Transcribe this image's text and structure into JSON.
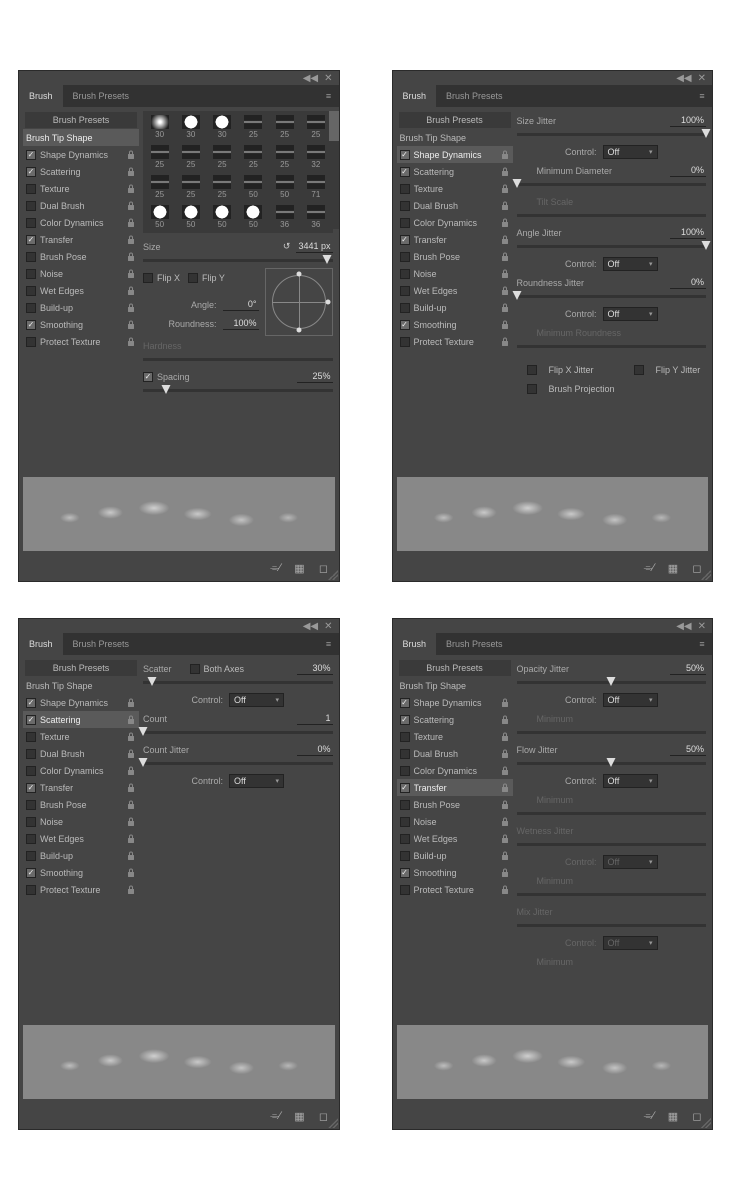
{
  "tabs": {
    "brush": "Brush",
    "presets": "Brush Presets"
  },
  "sidebar": {
    "presets_btn": "Brush Presets",
    "tip_shape": "Brush Tip Shape",
    "items": [
      {
        "label": "Shape Dynamics",
        "checked": true
      },
      {
        "label": "Scattering",
        "checked": true
      },
      {
        "label": "Texture",
        "checked": false
      },
      {
        "label": "Dual Brush",
        "checked": false
      },
      {
        "label": "Color Dynamics",
        "checked": false
      },
      {
        "label": "Transfer",
        "checked": true
      },
      {
        "label": "Brush Pose",
        "checked": false
      },
      {
        "label": "Noise",
        "checked": false
      },
      {
        "label": "Wet Edges",
        "checked": false
      },
      {
        "label": "Build-up",
        "checked": false
      },
      {
        "label": "Smoothing",
        "checked": true
      },
      {
        "label": "Protect Texture",
        "checked": false
      }
    ]
  },
  "panel1": {
    "selected": "Brush Tip Shape",
    "tips": [
      {
        "t": "soft",
        "s": "30"
      },
      {
        "t": "hard",
        "s": "30"
      },
      {
        "t": "hard",
        "s": "30"
      },
      {
        "t": "stroke",
        "s": "25"
      },
      {
        "t": "stroke",
        "s": "25"
      },
      {
        "t": "stroke",
        "s": "25"
      },
      {
        "t": "stroke",
        "s": "25"
      },
      {
        "t": "stroke",
        "s": "25"
      },
      {
        "t": "stroke",
        "s": "25"
      },
      {
        "t": "stroke",
        "s": "25"
      },
      {
        "t": "stroke",
        "s": "25"
      },
      {
        "t": "stroke",
        "s": "32"
      },
      {
        "t": "stroke",
        "s": "25"
      },
      {
        "t": "stroke",
        "s": "25"
      },
      {
        "t": "stroke",
        "s": "25"
      },
      {
        "t": "stroke",
        "s": "50"
      },
      {
        "t": "stroke",
        "s": "50"
      },
      {
        "t": "stroke",
        "s": "71"
      },
      {
        "t": "hard",
        "s": "50"
      },
      {
        "t": "hard",
        "s": "50"
      },
      {
        "t": "hard",
        "s": "50"
      },
      {
        "t": "hard",
        "s": "50"
      },
      {
        "t": "stroke",
        "s": "36"
      },
      {
        "t": "stroke",
        "s": "36"
      }
    ],
    "size_label": "Size",
    "size_value": "3441 px",
    "flipx": "Flip X",
    "flipy": "Flip Y",
    "angle_label": "Angle:",
    "angle_value": "0°",
    "roundness_label": "Roundness:",
    "roundness_value": "100%",
    "hardness_label": "Hardness",
    "spacing_label": "Spacing",
    "spacing_value": "25%"
  },
  "panel2": {
    "selected": "Shape Dynamics",
    "size_jitter_label": "Size Jitter",
    "size_jitter_value": "100%",
    "control_label": "Control:",
    "control_off": "Off",
    "min_diam_label": "Minimum Diameter",
    "min_diam_value": "0%",
    "tilt_scale_label": "Tilt Scale",
    "angle_jitter_label": "Angle Jitter",
    "angle_jitter_value": "100%",
    "round_jitter_label": "Roundness Jitter",
    "round_jitter_value": "0%",
    "min_round_label": "Minimum Roundness",
    "flipx_jitter": "Flip X Jitter",
    "flipy_jitter": "Flip Y Jitter",
    "brush_proj": "Brush Projection"
  },
  "panel3": {
    "selected": "Scattering",
    "scatter_label": "Scatter",
    "both_axes": "Both Axes",
    "scatter_value": "30%",
    "control_label": "Control:",
    "control_off": "Off",
    "count_label": "Count",
    "count_value": "1",
    "count_jitter_label": "Count Jitter",
    "count_jitter_value": "0%"
  },
  "panel4": {
    "selected": "Transfer",
    "opacity_jitter_label": "Opacity Jitter",
    "opacity_jitter_value": "50%",
    "control_label": "Control:",
    "control_off": "Off",
    "minimum_label": "Minimum",
    "flow_jitter_label": "Flow Jitter",
    "flow_jitter_value": "50%",
    "wetness_jitter_label": "Wetness Jitter",
    "mix_jitter_label": "Mix Jitter"
  }
}
